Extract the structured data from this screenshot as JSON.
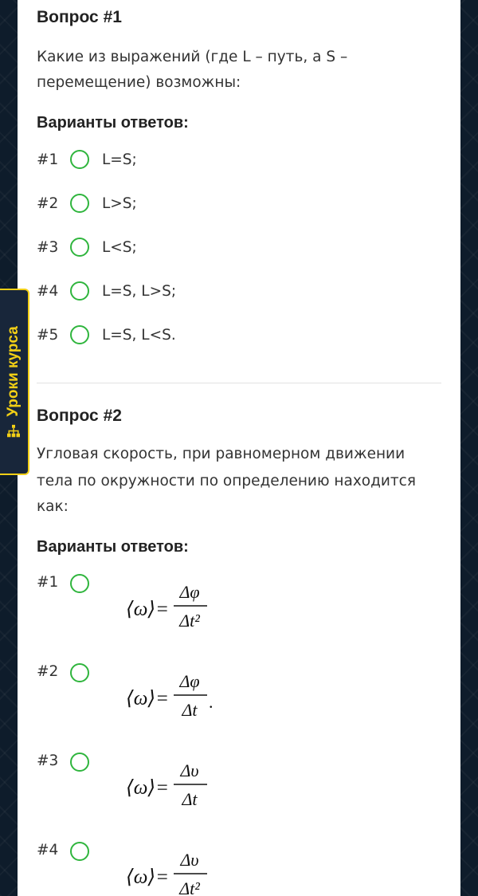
{
  "side_tab": {
    "label": "Уроки курса",
    "icon": "sitemap-icon",
    "accent": "#f2cf16"
  },
  "radio_color": "#2fb53d",
  "questions": [
    {
      "title": "Вопрос #1",
      "text_lines": [
        "Какие из выражений (где L – путь, а S –",
        "перемещение) возможны:"
      ],
      "variants_label": "Варианты ответов:",
      "options": [
        {
          "num": "#1",
          "text": "L=S;"
        },
        {
          "num": "#2",
          "text": "L>S;"
        },
        {
          "num": "#3",
          "text": "L<S;"
        },
        {
          "num": "#4",
          "text": "L=S, L>S;"
        },
        {
          "num": "#5",
          "text": "L=S, L<S."
        }
      ]
    },
    {
      "title": "Вопрос #2",
      "text_lines": [
        "Угловая скорость, при равномерном движении",
        "тела по окружности по определению находится",
        "как:"
      ],
      "variants_label": "Варианты ответов:",
      "options": [
        {
          "num": "#1",
          "lhs": "⟨ω⟩=",
          "num_expr": "Δφ",
          "den_expr": "Δt²",
          "tail": ""
        },
        {
          "num": "#2",
          "lhs": "⟨ω⟩=",
          "num_expr": "Δφ",
          "den_expr": "Δt",
          "tail": "."
        },
        {
          "num": "#3",
          "lhs": "⟨ω⟩=",
          "num_expr": "Δυ",
          "den_expr": "Δt",
          "tail": ""
        },
        {
          "num": "#4",
          "lhs": "⟨ω⟩=",
          "num_expr": "Δυ",
          "den_expr": "Δt²",
          "tail": ""
        }
      ]
    }
  ]
}
